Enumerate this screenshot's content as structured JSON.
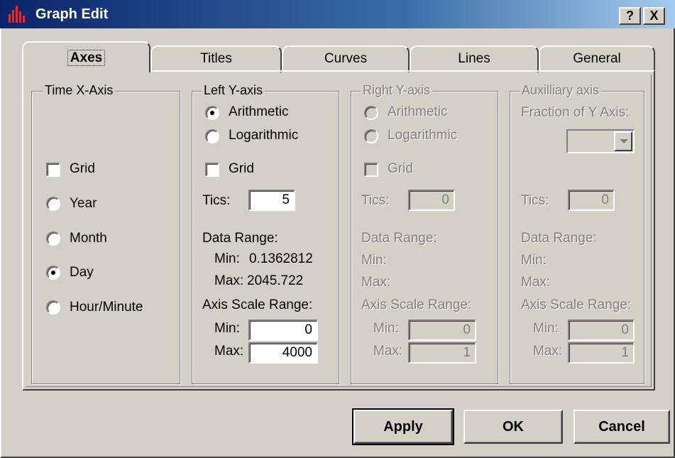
{
  "window": {
    "title": "Graph Edit",
    "help_label": "?",
    "close_label": "X",
    "icon": "bar-chart-icon"
  },
  "tabs": [
    {
      "label": "Axes",
      "selected": true
    },
    {
      "label": "Titles",
      "selected": false
    },
    {
      "label": "Curves",
      "selected": false
    },
    {
      "label": "Lines",
      "selected": false
    },
    {
      "label": "General",
      "selected": false
    }
  ],
  "time_x_axis": {
    "title": "Time X-Axis",
    "grid_label": "Grid",
    "grid_checked": false,
    "options": [
      {
        "label": "Year",
        "selected": false
      },
      {
        "label": "Month",
        "selected": false
      },
      {
        "label": "Day",
        "selected": true
      },
      {
        "label": "Hour/Minute",
        "selected": false
      }
    ]
  },
  "left_y_axis": {
    "title": "Left Y-axis",
    "arithmetic_label": "Arithmetic",
    "logarithmic_label": "Logarithmic",
    "scale": "Arithmetic",
    "grid_label": "Grid",
    "grid_checked": false,
    "tics_label": "Tics:",
    "tics_value": "5",
    "data_range_label": "Data Range:",
    "min_label": "Min:",
    "min_value": "0.1362812",
    "max_label": "Max:",
    "max_value": "2045.722",
    "axis_scale_label": "Axis Scale Range:",
    "scale_min_label": "Min:",
    "scale_min_value": "0",
    "scale_max_label": "Max:",
    "scale_max_value": "4000"
  },
  "right_y_axis": {
    "title": "Right Y-axis",
    "arithmetic_label": "Arithmetic",
    "logarithmic_label": "Logarithmic",
    "grid_label": "Grid",
    "tics_label": "Tics:",
    "tics_value": "0",
    "data_range_label": "Data Range:",
    "min_label": "Min:",
    "max_label": "Max:",
    "axis_scale_label": "Axis Scale Range:",
    "scale_min_label": "Min:",
    "scale_min_value": "0",
    "scale_max_label": "Max:",
    "scale_max_value": "1"
  },
  "auxiliary_axis": {
    "title": "Auxilliary axis",
    "fraction_label": "Fraction of Y Axis:",
    "tics_label": "Tics:",
    "tics_value": "0",
    "data_range_label": "Data Range:",
    "min_label": "Min:",
    "max_label": "Max:",
    "axis_scale_label": "Axis Scale Range:",
    "scale_min_label": "Min:",
    "scale_min_value": "0",
    "scale_max_label": "Max:",
    "scale_max_value": "1"
  },
  "buttons": {
    "apply": "Apply",
    "ok": "OK",
    "cancel": "Cancel"
  }
}
